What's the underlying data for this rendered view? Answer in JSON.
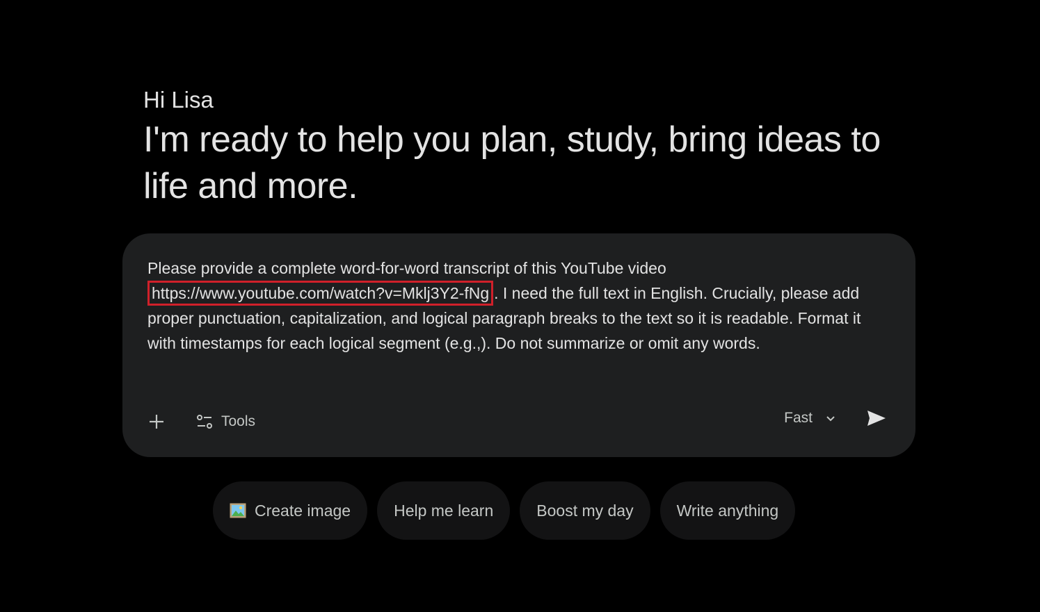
{
  "greeting": "Hi Lisa",
  "headline": "I'm ready to help you plan, study, bring ideas to life and more.",
  "composer": {
    "prompt_before": "Please provide a complete word-for-word transcript of this YouTube video ",
    "prompt_url": "https://www.youtube.com/watch?v=Mklj3Y2-fNg",
    "prompt_after": ". I need the full text in English. Crucially, please add proper punctuation, capitalization, and logical paragraph breaks to the text so it is readable. Format it with timestamps for each logical segment (e.g.,). Do not summarize or omit any words.",
    "tools_label": "Tools",
    "model_label": "Fast",
    "icons": {
      "add": "plus-icon",
      "tools": "tools-sliders-icon",
      "model": "chevron-down-icon",
      "send": "send-icon"
    },
    "url_highlight_color": "#d0202a"
  },
  "chips": [
    {
      "label": "Create image",
      "icon": "framed-picture-icon"
    },
    {
      "label": "Help me learn"
    },
    {
      "label": "Boost my day"
    },
    {
      "label": "Write anything"
    }
  ]
}
